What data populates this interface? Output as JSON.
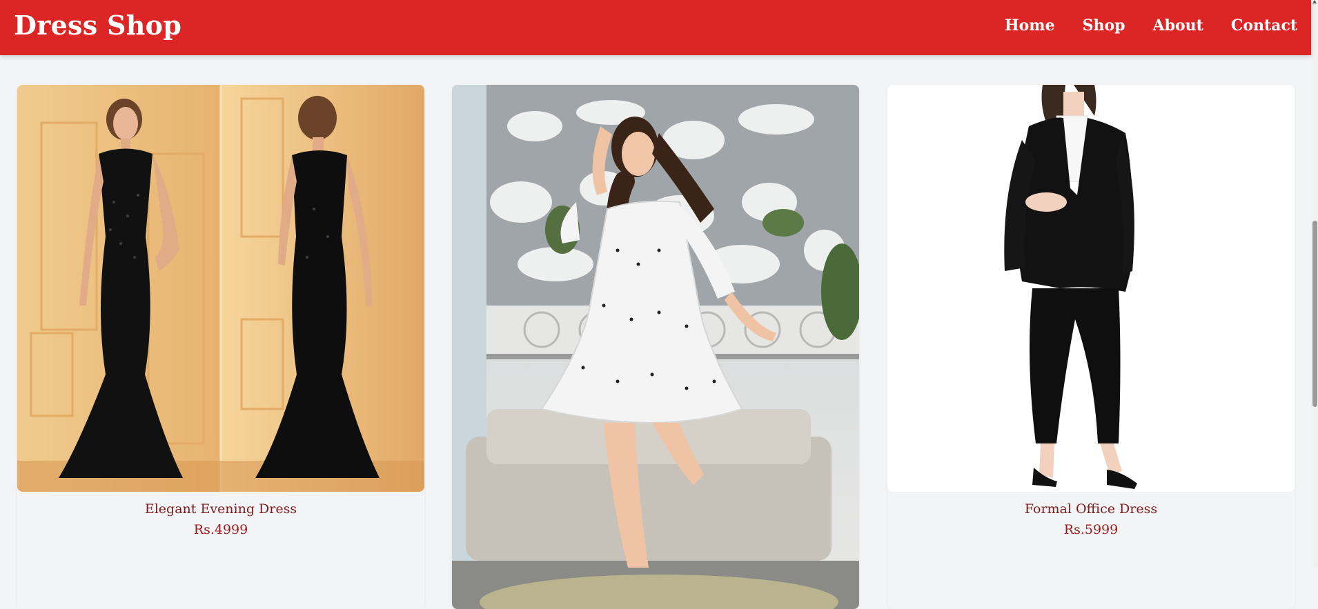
{
  "header": {
    "brand": "Dress Shop",
    "nav": [
      "Home",
      "Shop",
      "About",
      "Contact"
    ]
  },
  "products": [
    {
      "title": "Elegant Evening Dress",
      "price": "Rs.4999",
      "image": "two-views-black-sequin-gown-icon"
    },
    {
      "title": "",
      "price": "",
      "image": "white-tiered-dress-model-icon"
    },
    {
      "title": "Formal Office Dress",
      "price": "Rs.5999",
      "image": "black-pantsuit-icon"
    }
  ],
  "colors": {
    "accent": "#dc2626",
    "product_text": "#7f1d1d",
    "page_bg": "#f3f4f6"
  }
}
